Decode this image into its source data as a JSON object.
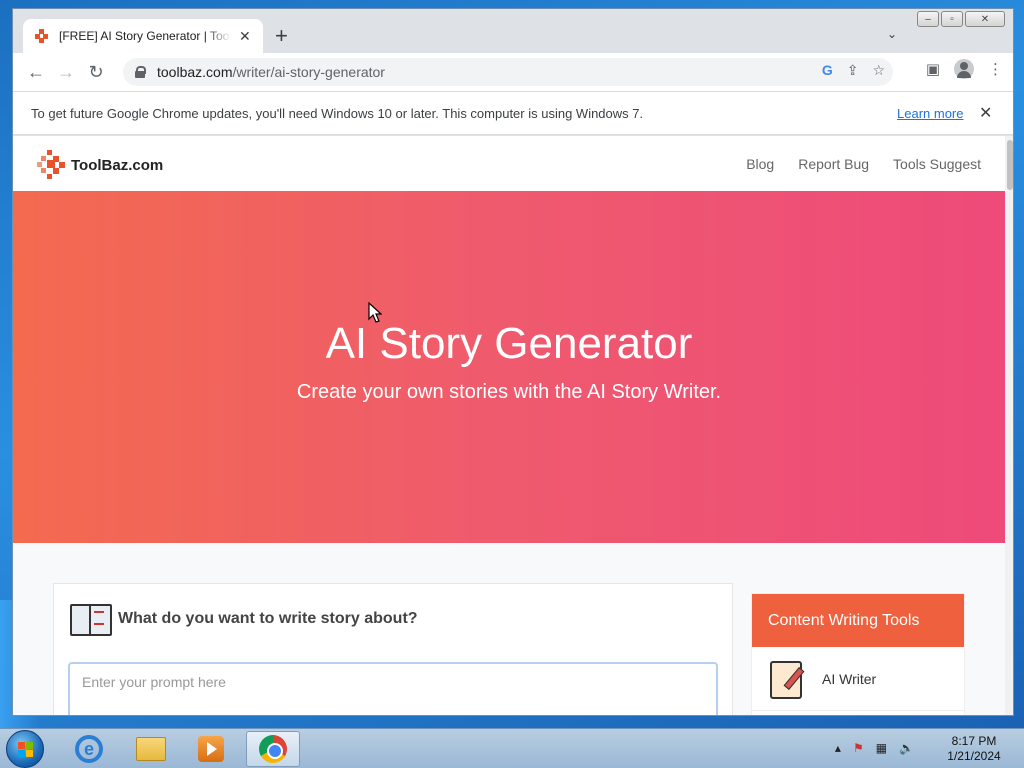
{
  "browser": {
    "tab_title": "[FREE] AI Story Generator | ToolBaz",
    "url_host": "toolbaz.com",
    "url_path": "/writer/ai-story-generator",
    "infobar_message": "To get future Google Chrome updates, you'll need Windows 10 or later. This computer is using Windows 7.",
    "infobar_link": "Learn more"
  },
  "site": {
    "logo_text": "ToolBaz.com",
    "nav": [
      "Blog",
      "Report Bug",
      "Tools Suggest"
    ]
  },
  "hero": {
    "title": "AI Story Generator",
    "subtitle": "Create your own stories with the AI Story Writer."
  },
  "card": {
    "title": "What do you want to write story about?",
    "input_placeholder": "Enter your prompt here"
  },
  "sidebar": {
    "heading": "Content Writing Tools",
    "items": [
      {
        "label": "AI Writer"
      }
    ]
  },
  "taskbar": {
    "time": "8:17 PM",
    "date": "1/21/2024"
  },
  "colors": {
    "hero_start": "#f36a4f",
    "hero_end": "#ee4a7a",
    "accent": "#ef603e",
    "link": "#1a73e8"
  }
}
